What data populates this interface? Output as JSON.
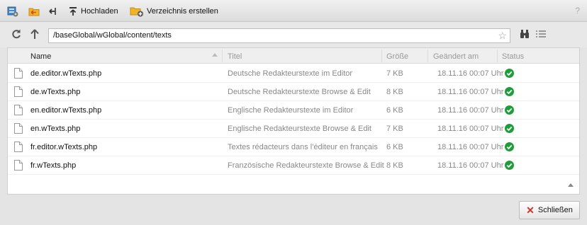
{
  "toolbar": {
    "upload_label": "Hochladen",
    "create_dir_label": "Verzeichnis erstellen",
    "help_label": "?"
  },
  "nav": {
    "path": "/baseGlobal/wGlobal/content/texts",
    "star": "☆"
  },
  "columns": {
    "name": "Name",
    "title": "Titel",
    "size": "Größe",
    "modified": "Geändert am",
    "status": "Status"
  },
  "files": [
    {
      "name": "de.editor.wTexts.php",
      "title": "Deutsche Redakteurstexte im Editor",
      "size": "7 KB",
      "modified": "18.11.16 00:07 Uhr",
      "status": "ok"
    },
    {
      "name": "de.wTexts.php",
      "title": "Deutsche Redakteurstexte Browse & Edit",
      "size": "8 KB",
      "modified": "18.11.16 00:07 Uhr",
      "status": "ok"
    },
    {
      "name": "en.editor.wTexts.php",
      "title": "Englische Redakteurstexte im Editor",
      "size": "6 KB",
      "modified": "18.11.16 00:07 Uhr",
      "status": "ok"
    },
    {
      "name": "en.wTexts.php",
      "title": "Englische Redakteurstexte Browse & Edit",
      "size": "7 KB",
      "modified": "18.11.16 00:07 Uhr",
      "status": "ok"
    },
    {
      "name": "fr.editor.wTexts.php",
      "title": "Textes rédacteurs dans l'éditeur en français",
      "size": "6 KB",
      "modified": "18.11.16 00:07 Uhr",
      "status": "ok"
    },
    {
      "name": "fr.wTexts.php",
      "title": "Französische Redakteurstexte Browse & Edit",
      "size": "8 KB",
      "modified": "18.11.16 00:07 Uhr",
      "status": "ok"
    }
  ],
  "footer": {
    "close_label": "Schließen"
  },
  "colors": {
    "status_ok": "#1f9d3a",
    "close_x": "#d0332b",
    "folder": "#f0b429"
  }
}
